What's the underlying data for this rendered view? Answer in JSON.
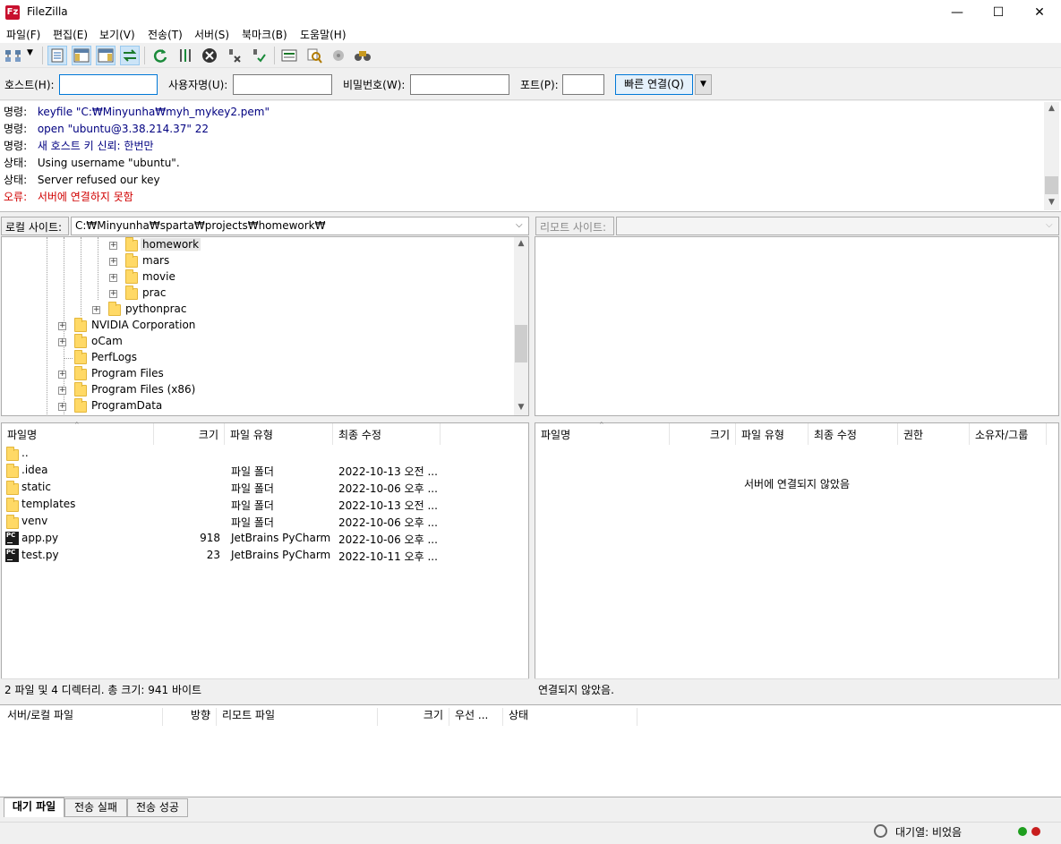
{
  "window": {
    "title": "FileZilla",
    "minimize": "—",
    "maximize": "☐",
    "close": "✕"
  },
  "menu": [
    "파일(F)",
    "편집(E)",
    "보기(V)",
    "전송(T)",
    "서버(S)",
    "북마크(B)",
    "도움말(H)"
  ],
  "toolbar": {
    "icons": [
      "site-manager-icon",
      "dropdown-arrow-icon",
      "toggle-message-log-icon",
      "toggle-local-tree-icon",
      "toggle-remote-tree-icon",
      "toggle-transfer-queue-icon",
      "refresh-icon",
      "process-queue-icon",
      "cancel-icon",
      "disconnect-icon",
      "reconnect-icon",
      "directory-comparison-icon",
      "filter-icon",
      "sync-browse-icon",
      "search-icon"
    ]
  },
  "quickconnect": {
    "host_label": "호스트(H):",
    "host_value": "",
    "user_label": "사용자명(U):",
    "user_value": "",
    "pass_label": "비밀번호(W):",
    "pass_value": "",
    "port_label": "포트(P):",
    "port_value": "",
    "connect_label": "빠른 연결(Q)"
  },
  "log": [
    {
      "kind": "명령:",
      "text": "keyfile \"C:₩Minyunha₩myh_mykey2.pem\"",
      "color": "#000080"
    },
    {
      "kind": "명령:",
      "text": "open \"ubuntu@3.38.214.37\" 22",
      "color": "#000080"
    },
    {
      "kind": "명령:",
      "text": "새 호스트 키 신뢰: 한번만",
      "color": "#000080"
    },
    {
      "kind": "상태:",
      "text": "Using username \"ubuntu\".",
      "color": "#000000"
    },
    {
      "kind": "상태:",
      "text": "Server refused our key",
      "color": "#000000"
    },
    {
      "kind": "오류:",
      "text": "서버에 연결하지 못함",
      "color": "#d00000"
    }
  ],
  "local": {
    "site_label": "로컬 사이트:",
    "path": "C:₩Minyunha₩sparta₩projects₩homework₩",
    "tree": [
      {
        "label": "homework",
        "selected": true
      },
      {
        "label": "mars"
      },
      {
        "label": "movie"
      },
      {
        "label": "prac"
      },
      {
        "label": "pythonprac"
      },
      {
        "label": "NVIDIA Corporation"
      },
      {
        "label": "oCam"
      },
      {
        "label": "PerfLogs"
      },
      {
        "label": "Program Files"
      },
      {
        "label": "Program Files (x86)"
      },
      {
        "label": "ProgramData"
      }
    ],
    "columns": [
      "파일명",
      "크기",
      "파일 유형",
      "최종 수정"
    ],
    "files": [
      {
        "name": "..",
        "size": "",
        "type": "",
        "modified": "",
        "icon": "folder-icon"
      },
      {
        "name": ".idea",
        "size": "",
        "type": "파일 폴더",
        "modified": "2022-10-13 오전 ...",
        "icon": "folder-icon"
      },
      {
        "name": "static",
        "size": "",
        "type": "파일 폴더",
        "modified": "2022-10-06 오후 ...",
        "icon": "folder-icon"
      },
      {
        "name": "templates",
        "size": "",
        "type": "파일 폴더",
        "modified": "2022-10-13 오전 ...",
        "icon": "folder-icon"
      },
      {
        "name": "venv",
        "size": "",
        "type": "파일 폴더",
        "modified": "2022-10-06 오후 ...",
        "icon": "folder-icon"
      },
      {
        "name": "app.py",
        "size": "918",
        "type": "JetBrains PyCharm",
        "modified": "2022-10-06 오후 ...",
        "icon": "pycharm-file-icon"
      },
      {
        "name": "test.py",
        "size": "23",
        "type": "JetBrains PyCharm",
        "modified": "2022-10-11 오후 ...",
        "icon": "pycharm-file-icon"
      }
    ],
    "status": "2 파일 및 4 디렉터리. 총 크기: 941 바이트"
  },
  "remote": {
    "site_label": "리모트 사이트:",
    "path": "",
    "columns": [
      "파일명",
      "크기",
      "파일 유형",
      "최종 수정",
      "권한",
      "소유자/그룹"
    ],
    "empty_message": "서버에 연결되지 않았음",
    "status": "연결되지 않았음."
  },
  "queue": {
    "columns": [
      "서버/로컬 파일",
      "방향",
      "리모트 파일",
      "크기",
      "우선 ...",
      "상태"
    ],
    "tabs": [
      "대기 파일",
      "전송 실패",
      "전송 성공"
    ]
  },
  "statusbar": {
    "queue_label": "대기열: 비었음",
    "colors": {
      "led_green": "#1e9e1e",
      "led_red": "#c81e1e"
    }
  }
}
